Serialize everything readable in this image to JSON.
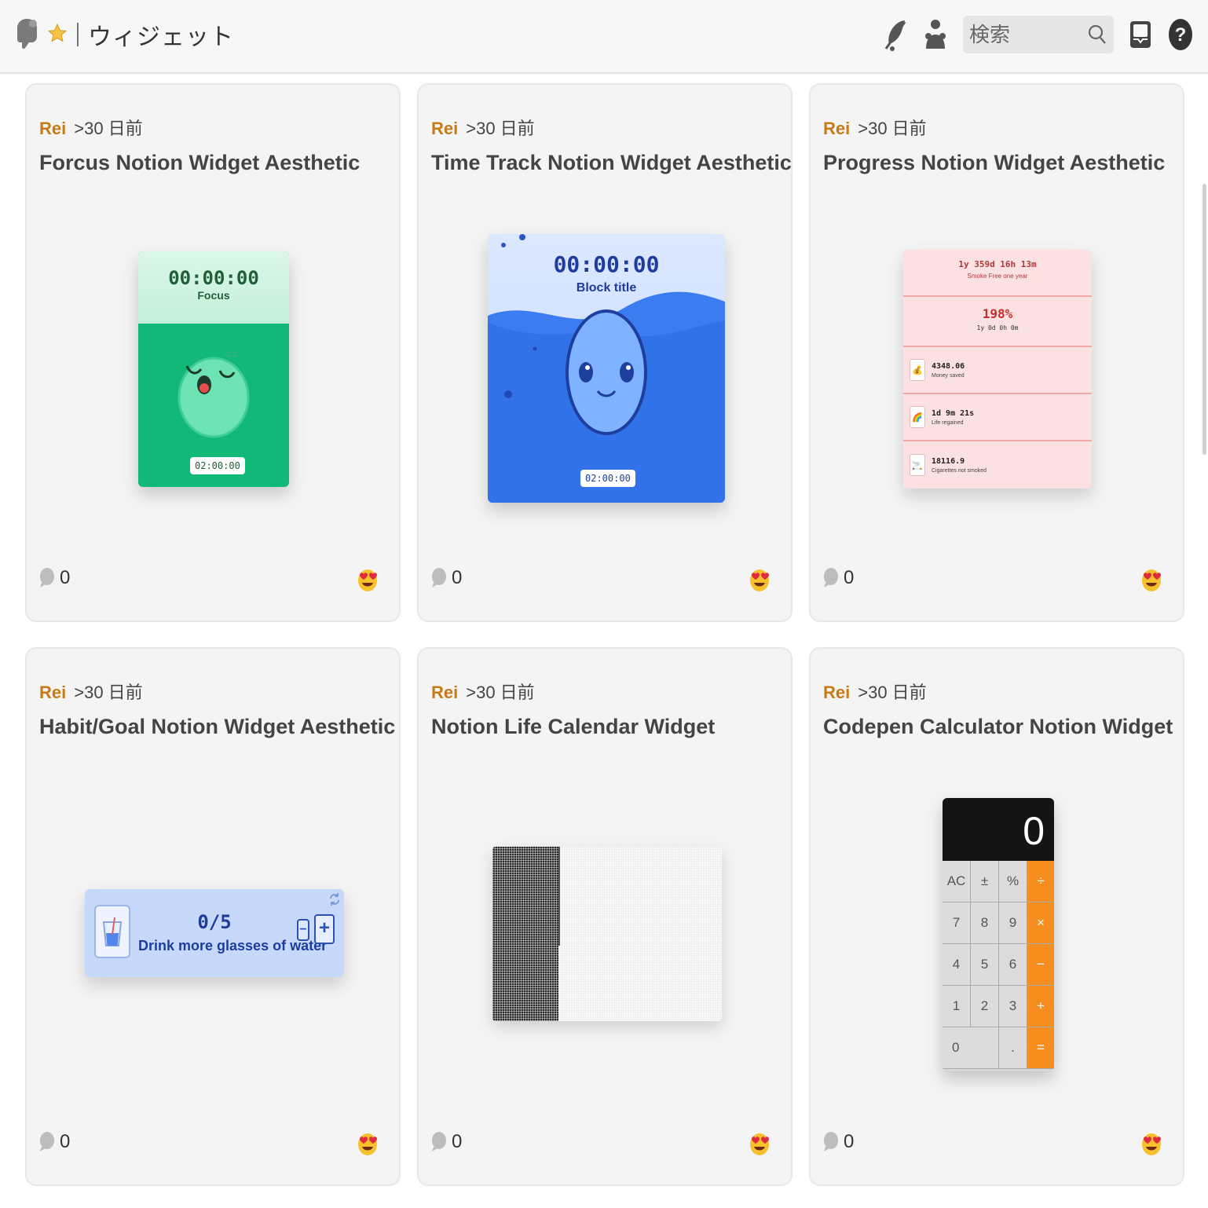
{
  "header": {
    "title": "ウィジェット",
    "search_placeholder": "検索"
  },
  "cards": [
    {
      "author": "Rei",
      "time": ">30 日前",
      "title": "Forcus Notion Widget Aesthetic",
      "comments": "0"
    },
    {
      "author": "Rei",
      "time": ">30 日前",
      "title": "Time Track Notion Widget Aesthetic",
      "comments": "0"
    },
    {
      "author": "Rei",
      "time": ">30 日前",
      "title": "Progress Notion Widget Aesthetic",
      "comments": "0"
    },
    {
      "author": "Rei",
      "time": ">30 日前",
      "title": "Habit/Goal Notion Widget Aesthetic",
      "comments": "0"
    },
    {
      "author": "Rei",
      "time": ">30 日前",
      "title": "Notion Life Calendar Widget",
      "comments": "0"
    },
    {
      "author": "Rei",
      "time": ">30 日前",
      "title": "Codepen Calculator Notion Widget",
      "comments": "0"
    }
  ],
  "thumbs": {
    "focus": {
      "time": "00:00:00",
      "label": "Focus",
      "timer": "02:00:00"
    },
    "water": {
      "time": "00:00:00",
      "label": "Block title",
      "timer": "02:00:00"
    },
    "progress": {
      "head": "1y 359d 16h 13m",
      "sub": "Smoke Free one year",
      "pct": "198%",
      "pct_sub": "1y 0d 0h 0m",
      "rows": [
        {
          "icon": "money-bag-icon",
          "value": "4348.06",
          "label": "Money saved"
        },
        {
          "icon": "rainbow-icon",
          "value": "1d 9m 21s",
          "label": "Life regained"
        },
        {
          "icon": "cigarette-icon",
          "value": "18116.9",
          "label": "Cigarettes not smoked"
        }
      ]
    },
    "habit": {
      "count": "0/5",
      "desc": "Drink more glasses of water",
      "minus": "−",
      "plus": "+"
    },
    "calc": {
      "display": "0",
      "keys": [
        "AC",
        "±",
        "%",
        "÷",
        "7",
        "8",
        "9",
        "×",
        "4",
        "5",
        "6",
        "−",
        "1",
        "2",
        "3",
        "+",
        "0",
        ".",
        "="
      ]
    }
  },
  "colors": {
    "author": "#c77a16",
    "accent_orange": "#f58e1e",
    "focus_green": "#12b877",
    "water_blue": "#3b7cf0"
  }
}
